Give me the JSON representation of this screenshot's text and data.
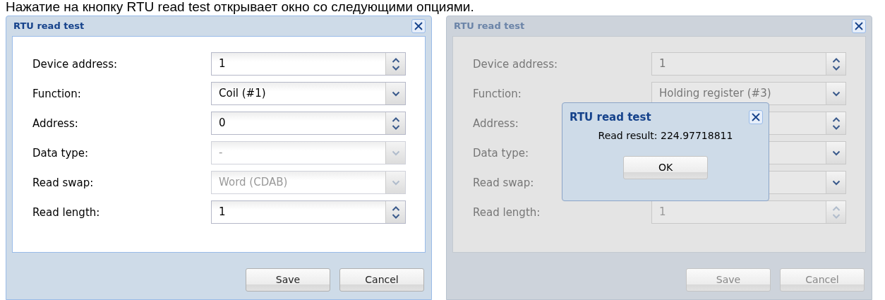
{
  "caption": "Нажатие на кнопку RTU read test открывает окно со следующими опциями.",
  "dialogs": [
    {
      "title": "RTU read test",
      "masked": false,
      "fields": [
        {
          "label": "Device address:",
          "kind": "spinner",
          "value": "1",
          "disabled": false
        },
        {
          "label": "Function:",
          "kind": "combo",
          "value": "Coil (#1)",
          "disabled": false
        },
        {
          "label": "Address:",
          "kind": "spinner",
          "value": "0",
          "disabled": false
        },
        {
          "label": "Data type:",
          "kind": "combo",
          "value": "-",
          "disabled": true
        },
        {
          "label": "Read swap:",
          "kind": "combo",
          "value": "Word (CDAB)",
          "disabled": true
        },
        {
          "label": "Read length:",
          "kind": "spinner",
          "value": "1",
          "disabled": false
        }
      ],
      "buttons": [
        "Save",
        "Cancel"
      ]
    },
    {
      "title": "RTU read test",
      "masked": true,
      "fields": [
        {
          "label": "Device address:",
          "kind": "spinner",
          "value": "1",
          "disabled": false
        },
        {
          "label": "Function:",
          "kind": "combo",
          "value": "Holding register (#3)",
          "disabled": false
        },
        {
          "label": "Address:",
          "kind": "spinner",
          "disabled": false
        },
        {
          "label": "Data type:",
          "kind": "combo",
          "disabled": false
        },
        {
          "label": "Read swap:",
          "kind": "combo",
          "disabled": false
        },
        {
          "label": "Read length:",
          "kind": "spinner",
          "value": "1",
          "disabled": true
        }
      ],
      "buttons": [
        "Save",
        "Cancel"
      ],
      "message_box": {
        "title": "RTU read test",
        "text": "Read result: 224.97718811",
        "button": "OK"
      }
    }
  ]
}
